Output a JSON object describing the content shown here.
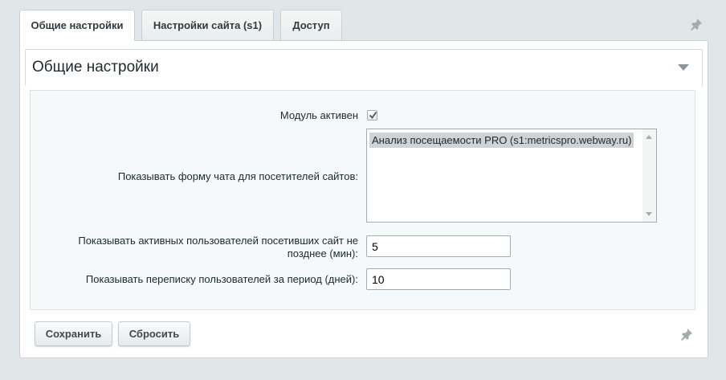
{
  "tabs": [
    {
      "label": "Общие настройки",
      "active": true
    },
    {
      "label": "Настройки сайта (s1)",
      "active": false
    },
    {
      "label": "Доступ",
      "active": false
    }
  ],
  "section": {
    "title": "Общие настройки"
  },
  "form": {
    "module_active": {
      "label": "Модуль активен",
      "checked": true
    },
    "chat_form_sites": {
      "label": "Показывать форму чата для посетителей сайтов:",
      "options": [
        "Анализ посещаемости PRO (s1:metricspro.webway.ru)"
      ],
      "selected": "Анализ посещаемости PRO (s1:metricspro.webway.ru)"
    },
    "active_users": {
      "label_line1": "Показывать активных пользователей посетивших сайт не",
      "label_line2": "позднее (мин):",
      "value": "5"
    },
    "chat_period": {
      "label": "Показывать переписку пользователей за период (дней):",
      "value": "10"
    }
  },
  "buttons": {
    "save_label": "Сохранить",
    "reset_label": "Сбросить"
  },
  "colors": {
    "background": "#e1e6e8",
    "panel": "#ffffff",
    "form_area": "#f5f9f9",
    "selected_option": "#cfd3d4"
  }
}
